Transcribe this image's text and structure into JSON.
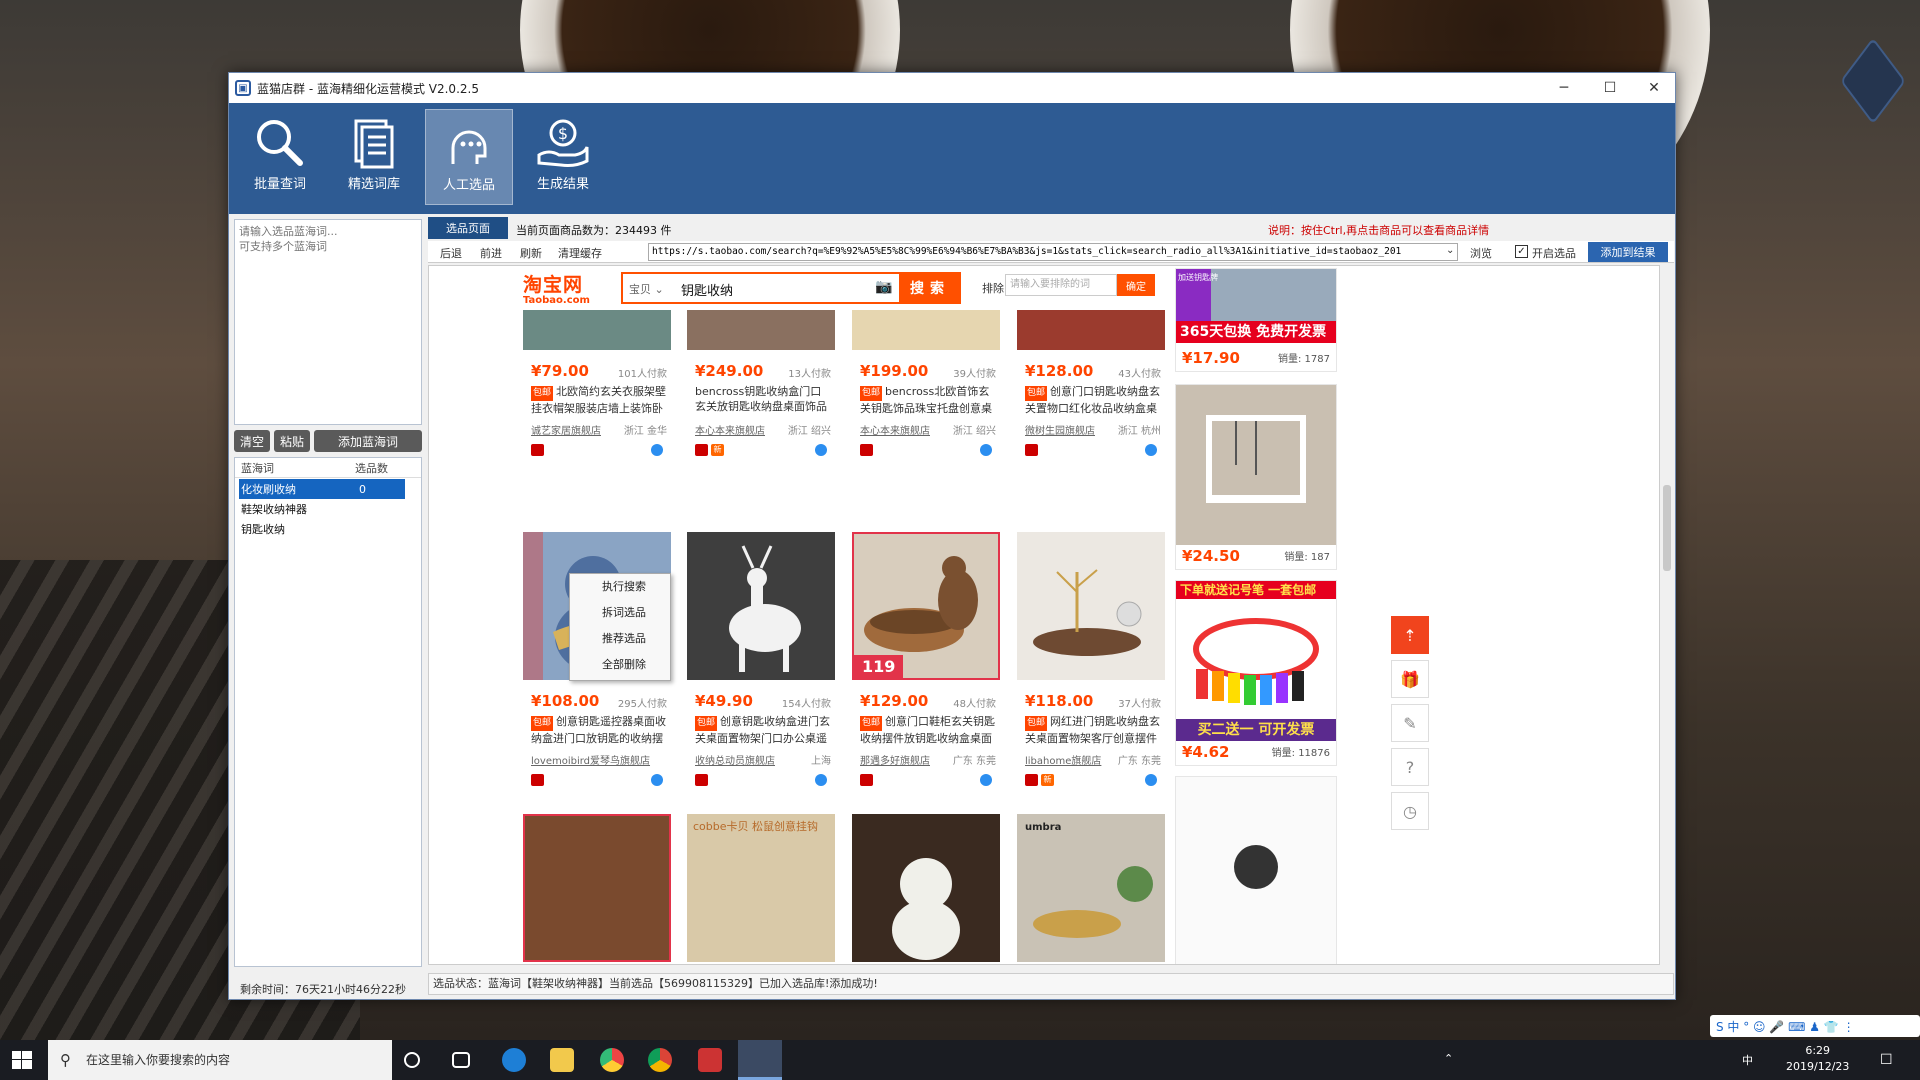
{
  "window": {
    "title": "蓝猫店群 - 蓝海精细化运营模式 V2.0.2.5",
    "min": "─",
    "max": "☐",
    "close": "✕"
  },
  "toolbar": {
    "items": [
      {
        "label": "批量查词",
        "icon": "magnifier-icon"
      },
      {
        "label": "精选词库",
        "icon": "document-list-icon"
      },
      {
        "label": "人工选品",
        "icon": "person-chat-icon",
        "active": true
      },
      {
        "label": "生成结果",
        "icon": "hand-money-icon"
      }
    ]
  },
  "left": {
    "input_placeholder": "请输入选品蓝海词...\n可支持多个蓝海词",
    "btn_clear": "清空",
    "btn_paste": "粘贴",
    "btn_add": "添加蓝海词",
    "col_word": "蓝海词",
    "col_count": "选品数",
    "rows": [
      {
        "word": "化妆刷收纳",
        "count": "0"
      },
      {
        "word": "鞋架收纳神器",
        "count": ""
      },
      {
        "word": "钥匙收纳",
        "count": ""
      }
    ],
    "time_left": "剩余时间：76天21小时46分22秒"
  },
  "context_menu": [
    "执行搜索",
    "拆词选品",
    "推荐选品",
    "全部删除"
  ],
  "right": {
    "tab": "选品页面",
    "count_text": "当前页面商品数为：234493 件",
    "tip": "说明：按住Ctrl,再点击商品可以查看商品详情",
    "nav": [
      "后退",
      "前进",
      "刷新",
      "清理缓存"
    ],
    "url": "https://s.taobao.com/search?q=%E9%92%A5%E5%8C%99%E6%94%B6%E7%BA%B3&js=1&stats_click=search_radio_all%3A1&initiative_id=staobaoz_201",
    "browse": "浏览",
    "enable_label": "开启选品",
    "enable_checked": "✓",
    "add_result": "添加到结果",
    "status": "选品状态：蓝海词【鞋架收纳神器】当前选品【569908115329】已加入选品库!添加成功!"
  },
  "taobao": {
    "logo1": "淘宝网",
    "logo2": "Taobao.com",
    "category": "宝贝 ⌄",
    "query": "钥匙收纳",
    "search_btn": "搜索",
    "exclude_label": "排除",
    "exclude_placeholder": "请输入要排除的词",
    "exclude_btn": "确定"
  },
  "products": [
    {
      "price": "¥79.00",
      "paid": "101人付款",
      "title": "北欧简约玄关衣服架壁挂衣帽架服装店墙上装饰卧室",
      "shop": "诚艺家居旗舰店",
      "loc": "浙江 金华",
      "by": "包邮",
      "img": "#6b8a84"
    },
    {
      "price": "¥249.00",
      "paid": "13人付款",
      "title": "bencross钥匙收纳盒门口玄关放钥匙收纳盘桌面饰品托盘",
      "shop": "本心本来旗舰店",
      "loc": "浙江 绍兴",
      "by": "",
      "img": "#8a7060"
    },
    {
      "price": "¥199.00",
      "paid": "39人付款",
      "title": "bencross北欧首饰玄关钥匙饰品珠宝托盘创意桌面置",
      "shop": "本心本来旗舰店",
      "loc": "浙江 绍兴",
      "by": "包邮",
      "img": "#e6d6b0"
    },
    {
      "price": "¥128.00",
      "paid": "43人付款",
      "title": "创意门口钥匙收纳盘玄关置物口红化妆品收纳盒桌面",
      "shop": "微树生园旗舰店",
      "loc": "浙江 杭州",
      "by": "包邮",
      "img": "#9b3b2e"
    },
    {
      "price": "¥108.00",
      "paid": "295人付款",
      "title": "创意钥匙遥控器桌面收纳盒进门口放钥匙的收纳摆",
      "shop": "lovemoibird爱琴鸟旗舰店",
      "loc": "",
      "by": "包邮",
      "img": "#5a78a6"
    },
    {
      "price": "¥49.90",
      "paid": "154人付款",
      "title": "创意钥匙收纳盒进门玄关桌面置物架门口办公桌遥控",
      "shop": "收纳总动员旗舰店",
      "loc": "上海",
      "by": "包邮",
      "img": "#4a4a4a"
    },
    {
      "price": "¥129.00",
      "paid": "48人付款",
      "title": "创意门口鞋柜玄关钥匙收纳摆件放钥匙收纳盒桌面客",
      "shop": "那遇多好旗舰店",
      "loc": "广东 东莞",
      "by": "包邮",
      "img": "#7a5a3a"
    },
    {
      "price": "¥118.00",
      "paid": "37人付款",
      "title": "网红进门钥匙收纳盘玄关桌面置物架客厅创意摆件鹿",
      "shop": "libahome旗舰店",
      "loc": "广东 东莞",
      "by": "包邮",
      "img": "#e8e4de"
    }
  ],
  "third_row_imgs": [
    "#7a4a2e",
    "#d9c9a8",
    "#3a2a20",
    "#c9c2b5"
  ],
  "third_row_brands": [
    "",
    "cobbe卡贝 松鼠创意挂钩",
    "",
    "umbra"
  ],
  "promo_119": "119",
  "ads": [
    {
      "banner": "365天包换 免费开发票",
      "price": "¥17.90",
      "sales": "销量: 1787",
      "tag": "加送钥匙牌"
    },
    {
      "banner": "",
      "price": "¥24.50",
      "sales": "销量: 187",
      "tag": ""
    },
    {
      "banner": "买二送一 可开发票",
      "price": "¥4.62",
      "sales": "销量: 11876",
      "tag": "下单就送记号笔 一套包邮"
    }
  ],
  "side_icons": [
    "arrow-up-icon",
    "gift-icon",
    "edit-icon",
    "help-icon",
    "clock-icon"
  ],
  "side_glyphs": [
    "⇡",
    "🎁",
    "✎",
    "?",
    "◷"
  ],
  "taskbar": {
    "search_placeholder": "在这里输入你要搜索的内容",
    "time": "6:29",
    "date": "2019/12/23",
    "ime_mode": "中",
    "ime_tray": "S 中 ° ☺ 🎤 ⌨ ♟ 👕 ⋮"
  }
}
